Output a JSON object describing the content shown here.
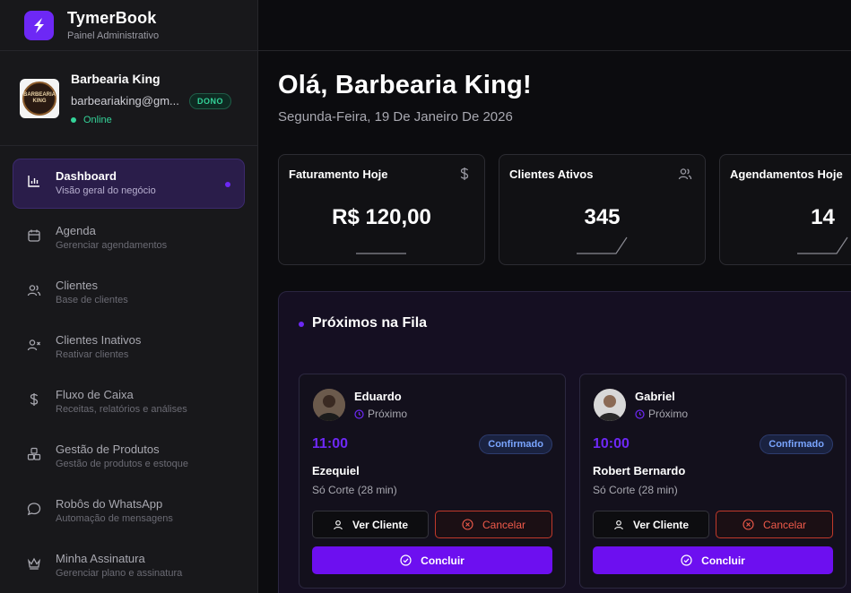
{
  "brand": {
    "name": "TymerBook",
    "subtitle": "Painel Administrativo",
    "accent": "#6d28f5"
  },
  "profile": {
    "name": "Barbearia King",
    "email": "barbeariaking@gm...",
    "role_badge": "DONO",
    "status": "Online",
    "logo_text_top": "BARBEARIA",
    "logo_text_bottom": "KING"
  },
  "nav": [
    {
      "label": "Dashboard",
      "desc": "Visão geral do negócio",
      "icon": "chart-icon",
      "active": true
    },
    {
      "label": "Agenda",
      "desc": "Gerenciar agendamentos",
      "icon": "calendar-icon"
    },
    {
      "label": "Clientes",
      "desc": "Base de clientes",
      "icon": "users-icon"
    },
    {
      "label": "Clientes Inativos",
      "desc": "Reativar clientes",
      "icon": "user-x-icon"
    },
    {
      "label": "Fluxo de Caixa",
      "desc": "Receitas, relatórios e análises",
      "icon": "dollar-icon"
    },
    {
      "label": "Gestão de Produtos",
      "desc": "Gestão de produtos e estoque",
      "icon": "boxes-icon"
    },
    {
      "label": "Robôs do WhatsApp",
      "desc": "Automação de mensagens",
      "icon": "message-icon"
    },
    {
      "label": "Minha Assinatura",
      "desc": "Gerenciar plano e assinatura",
      "icon": "crown-icon"
    }
  ],
  "main": {
    "greeting": "Olá, Barbearia King!",
    "date": "Segunda-Feira, 19 De Janeiro De 2026"
  },
  "stats": [
    {
      "title": "Faturamento Hoje",
      "value": "R$ 120,00",
      "icon": "dollar-icon"
    },
    {
      "title": "Clientes Ativos",
      "value": "345",
      "icon": "users-icon"
    },
    {
      "title": "Agendamentos Hoje",
      "value": "14",
      "icon": "calendar-icon"
    }
  ],
  "queue": {
    "title": "Próximos na Fila",
    "cards": [
      {
        "barber": "Eduardo",
        "status": "Próximo",
        "time": "11:00",
        "badge": "Confirmado",
        "client": "Ezequiel",
        "service": "Só Corte (28 min)",
        "view_label": "Ver Cliente",
        "cancel_label": "Cancelar",
        "done_label": "Concluir"
      },
      {
        "barber": "Gabriel",
        "status": "Próximo",
        "time": "10:00",
        "badge": "Confirmado",
        "client": "Robert Bernardo",
        "service": "Só Corte (28 min)",
        "view_label": "Ver Cliente",
        "cancel_label": "Cancelar",
        "done_label": "Concluir"
      }
    ]
  },
  "colors": {
    "background": "#0c0c0f",
    "sidebar": "#18181b",
    "primary": "#6d0ff0",
    "success": "#34d399",
    "danger": "#f05a4a",
    "info": "#7aa5ff"
  }
}
